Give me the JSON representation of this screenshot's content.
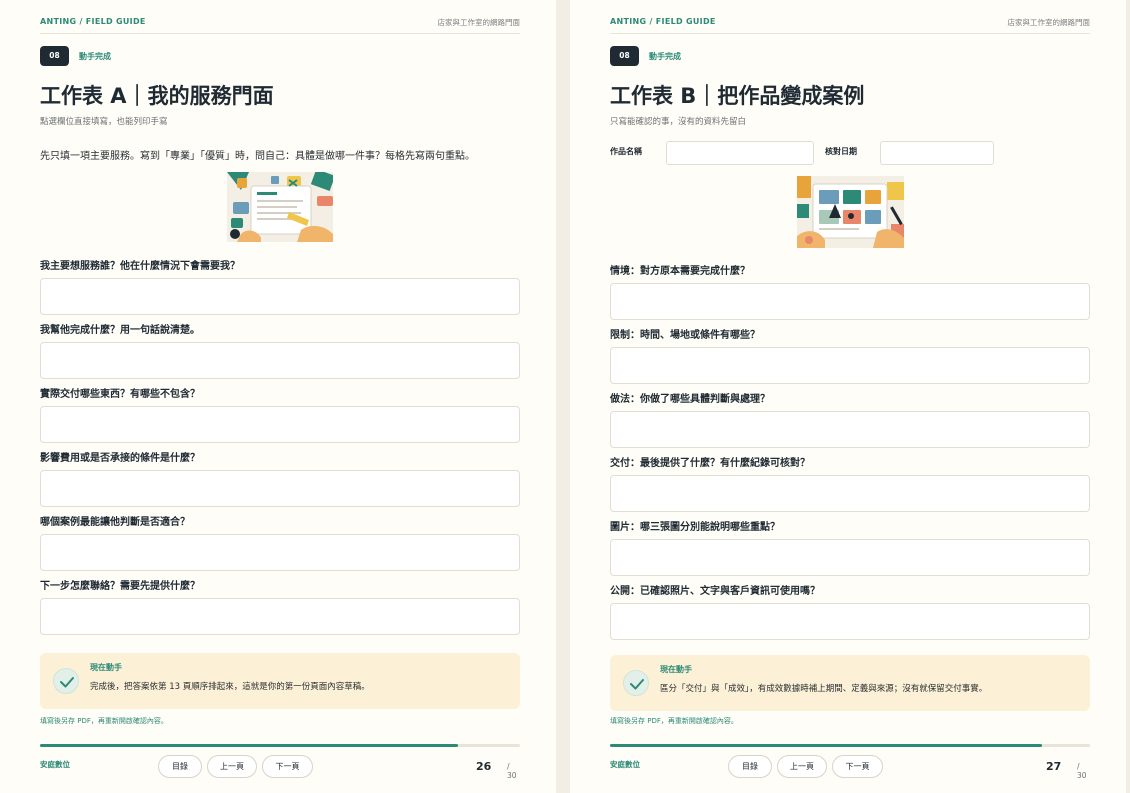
{
  "colors": {
    "accent": "#2c8a76",
    "dark": "#1f2a33",
    "callout_bg": "#fcf0d6",
    "page_bg": "#fffdf7"
  },
  "left": {
    "header": {
      "brand": "ANTING / FIELD GUIDE",
      "right": "店家與工作室的網路門面"
    },
    "badge": "08",
    "chapter": "動手完成",
    "title": "工作表 A｜我的服務門面",
    "subtitle": "點選欄位直接填寫，也能列印手寫",
    "intro": "先只填一項主要服務。寫到「專業」「優質」時，問自己：具體是做哪一件事？每格先寫兩句重點。",
    "illustration": "worksheet-writing-illustration",
    "questions": [
      {
        "label": "我主要想服務誰？他在什麼情況下會需要我？"
      },
      {
        "label": "我幫他完成什麼？用一句話說清楚。"
      },
      {
        "label": "實際交付哪些東西？有哪些不包含？"
      },
      {
        "label": "影響費用或是否承接的條件是什麼？"
      },
      {
        "label": "哪個案例最能讓他判斷是否適合？"
      },
      {
        "label": "下一步怎麼聯絡？需要先提供什麼？"
      }
    ],
    "callout": {
      "icon": "check-icon",
      "title": "現在動手",
      "text": "完成後，把答案依第 13 頁順序排起來，這就是你的第一份頁面內容草稿。"
    },
    "footnote": "填寫後另存 PDF，再重新開啟確認內容。",
    "progress": 0.87,
    "footer": {
      "brand": "安庭數位",
      "toc": "目錄",
      "prev": "上一頁",
      "next": "下一頁",
      "page": "26",
      "total": "/ 30"
    }
  },
  "right": {
    "header": {
      "brand": "ANTING / FIELD GUIDE",
      "right": "店家與工作室的網路門面"
    },
    "badge": "08",
    "chapter": "動手完成",
    "title": "工作表 B｜把作品變成案例",
    "subtitle": "只寫能確認的事，沒有的資料先留白",
    "meta": {
      "name_label": "作品名稱",
      "date_label": "核對日期"
    },
    "illustration": "case-study-photos-illustration",
    "questions": [
      {
        "label": "情境：對方原本需要完成什麼？"
      },
      {
        "label": "限制：時間、場地或條件有哪些？"
      },
      {
        "label": "做法：你做了哪些具體判斷與處理？"
      },
      {
        "label": "交付：最後提供了什麼？有什麼紀錄可核對？"
      },
      {
        "label": "圖片：哪三張圖分別能說明哪些重點？"
      },
      {
        "label": "公開：已確認照片、文字與客戶資訊可使用嗎？"
      }
    ],
    "callout": {
      "icon": "check-icon",
      "title": "現在動手",
      "text": "區分「交付」與「成效」，有成效數據時補上期間、定義與來源；沒有就保留交付事實。"
    },
    "footnote": "填寫後另存 PDF，再重新開啟確認內容。",
    "progress": 0.9,
    "footer": {
      "brand": "安庭數位",
      "toc": "目錄",
      "prev": "上一頁",
      "next": "下一頁",
      "page": "27",
      "total": "/ 30"
    }
  }
}
